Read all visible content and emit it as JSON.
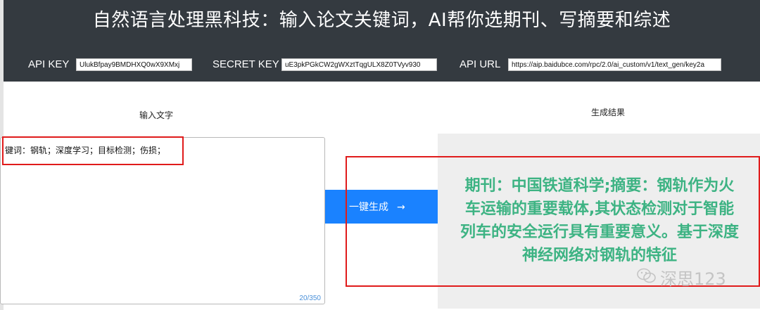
{
  "header": {
    "title": "自然语言处理黑科技：输入论文关键词，AI帮你选期刊、写摘要和综述",
    "api_key_label": "API KEY",
    "api_key_value": "UlukBfpay9BMDHXQ0wX9XMxj",
    "secret_key_label": "SECRET KEY",
    "secret_key_value": "uE3pkPGkCW2gWXztTqgULX8Z0TVyv930",
    "api_url_label": "API URL",
    "api_url_value": "https://aip.baidubce.com/rpc/2.0/ai_custom/v1/text_gen/key2a"
  },
  "input": {
    "label": "输入文字",
    "text": "键词：钢轨；深度学习；目标检测；伤损；",
    "counter": "20/350"
  },
  "button": {
    "label": "一键生成",
    "arrow": "→"
  },
  "output": {
    "label": "生成结果",
    "lines": [
      "期刊：中国铁道科学;摘要：钢轨作为火",
      "车运输的重要载体,其状态检测对于智能",
      "列车的安全运行具有重要意义。基于深度",
      "神经网络对钢轨的特征"
    ]
  },
  "watermark": {
    "text": "深思123"
  },
  "colors": {
    "header_bg": "#343a40",
    "button_bg": "#1a82ff",
    "result_text": "#3db383",
    "highlight_border": "#e01b1b"
  }
}
